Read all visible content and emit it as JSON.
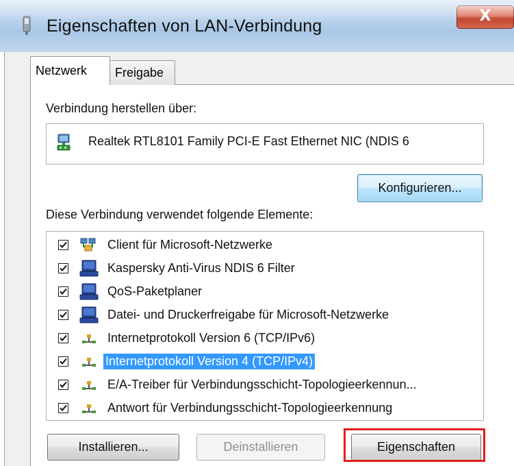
{
  "window": {
    "title": "Eigenschaften von LAN-Verbindung",
    "close_glyph": "X"
  },
  "tabs": [
    {
      "label": "Netzwerk",
      "active": true
    },
    {
      "label": "Freigabe",
      "active": false
    }
  ],
  "connection": {
    "label": "Verbindung herstellen über:",
    "adapter_name": "Realtek RTL8101 Family PCI-E Fast Ethernet NIC (NDIS 6",
    "adapter_icon": "network-adapter-icon",
    "configure_button": "Konfigurieren..."
  },
  "components": {
    "label": "Diese Verbindung verwendet folgende Elemente:",
    "items": [
      {
        "label": "Client für Microsoft-Netzwerke",
        "checked": true,
        "icon": "client-network-icon",
        "selected": false
      },
      {
        "label": "Kaspersky Anti-Virus NDIS 6 Filter",
        "checked": true,
        "icon": "service-computer-icon",
        "selected": false
      },
      {
        "label": "QoS-Paketplaner",
        "checked": true,
        "icon": "service-computer-icon",
        "selected": false
      },
      {
        "label": "Datei- und Druckerfreigabe für Microsoft-Netzwerke",
        "checked": true,
        "icon": "service-computer-icon",
        "selected": false
      },
      {
        "label": "Internetprotokoll Version 6 (TCP/IPv6)",
        "checked": true,
        "icon": "protocol-icon",
        "selected": false
      },
      {
        "label": "Internetprotokoll Version 4 (TCP/IPv4)",
        "checked": true,
        "icon": "protocol-icon",
        "selected": true
      },
      {
        "label": "E/A-Treiber für Verbindungsschicht-Topologieerkennun...",
        "checked": true,
        "icon": "protocol-icon",
        "selected": false
      },
      {
        "label": "Antwort für Verbindungsschicht-Topologieerkennung",
        "checked": true,
        "icon": "protocol-icon",
        "selected": false
      }
    ]
  },
  "buttons": {
    "install": "Installieren...",
    "uninstall": "Deinstallieren",
    "properties": "Eigenschaften"
  },
  "colors": {
    "selection": "#3399ff",
    "highlight_box": "#e31d1d"
  }
}
